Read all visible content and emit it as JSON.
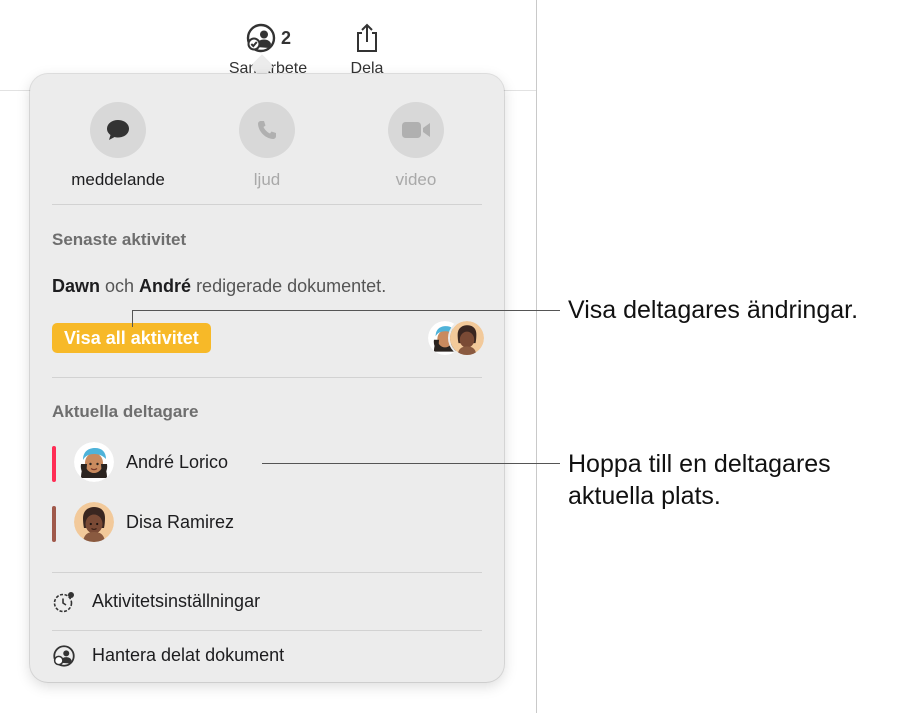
{
  "toolbar": {
    "collaborate": {
      "count": "2",
      "label": "Samarbete"
    },
    "share": {
      "label": "Dela"
    }
  },
  "communication": [
    {
      "label": "meddelande",
      "icon": "message-bubble-icon",
      "enabled": true
    },
    {
      "label": "ljud",
      "icon": "phone-icon",
      "enabled": false
    },
    {
      "label": "video",
      "icon": "video-camera-icon",
      "enabled": false
    }
  ],
  "recent_activity": {
    "title": "Senaste aktivitet",
    "name1": "Dawn",
    "conj": " och ",
    "name2": "André",
    "rest": " redigerade dokumentet.",
    "button_label": "Visa all aktivitet"
  },
  "current_participants": {
    "title": "Aktuella deltagare",
    "people": [
      {
        "name": "André Lorico",
        "color": "#ff2d55"
      },
      {
        "name": "Disa Ramirez",
        "color": "#a0594b"
      }
    ]
  },
  "menu": {
    "activity_settings": "Aktivitetsinställningar",
    "manage_shared": "Hantera delat dokument"
  },
  "callouts": {
    "view_changes": "Visa deltagares ändringar.",
    "jump_line1": "Hoppa till en deltagares",
    "jump_line2": "aktuella plats."
  },
  "colors": {
    "accent_yellow": "#f7b928"
  }
}
